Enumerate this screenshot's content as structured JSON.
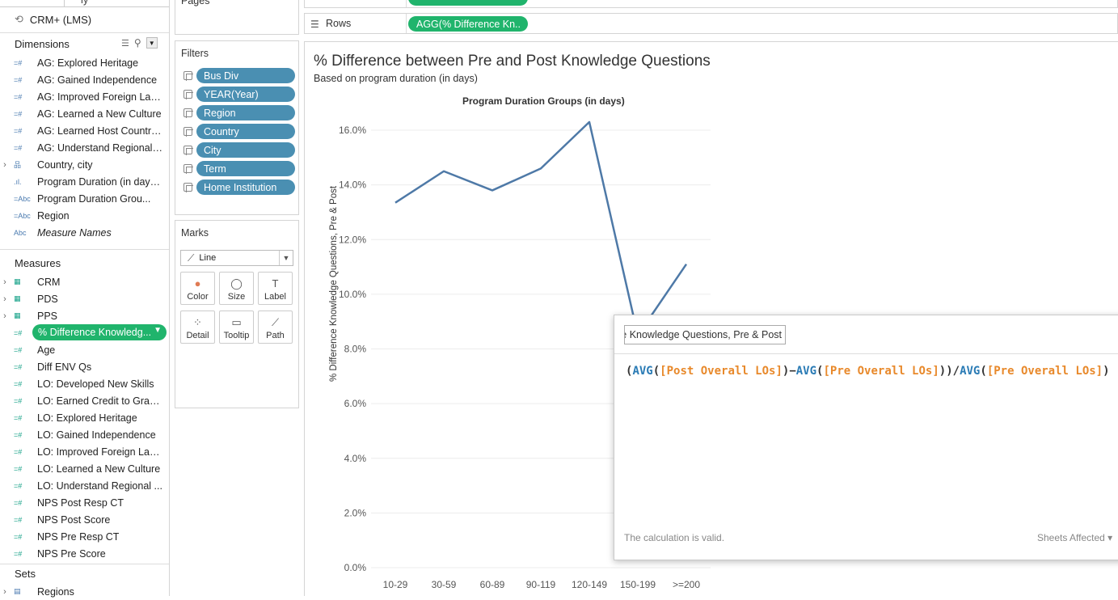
{
  "datasource": {
    "name": "CRM+ (LMS)",
    "tab_partial": "ly"
  },
  "dimensions": {
    "header": "Dimensions",
    "items": [
      {
        "icon": "=#",
        "label": "AG: Explored Heritage"
      },
      {
        "icon": "=#",
        "label": "AG: Gained Independence"
      },
      {
        "icon": "=#",
        "label": "AG: Improved Foreign Lan..."
      },
      {
        "icon": "=#",
        "label": "AG: Learned a New Culture"
      },
      {
        "icon": "=#",
        "label": "AG: Learned Host Country..."
      },
      {
        "icon": "=#",
        "label": "AG: Understand Regional ..."
      },
      {
        "icon": "品",
        "label": "Country, city"
      },
      {
        "icon": ".ıl.",
        "label": "Program Duration (in days..."
      },
      {
        "icon": "=Abc",
        "label": "Program Duration Grou..."
      },
      {
        "icon": "=Abc",
        "label": "Region"
      },
      {
        "icon": "Abc",
        "label": "Measure Names"
      }
    ]
  },
  "measures": {
    "header": "Measures",
    "items": [
      {
        "icon": "▦",
        "label": "CRM"
      },
      {
        "icon": "▦",
        "label": "PDS"
      },
      {
        "icon": "▦",
        "label": "PPS"
      },
      {
        "icon": "=#",
        "label": "% Difference Knowledg..."
      },
      {
        "icon": "=#",
        "label": "Age"
      },
      {
        "icon": "=#",
        "label": "Diff ENV Qs"
      },
      {
        "icon": "=#",
        "label": "LO: Developed New Skills"
      },
      {
        "icon": "=#",
        "label": "LO: Earned Credit to Grad..."
      },
      {
        "icon": "=#",
        "label": "LO: Explored Heritage"
      },
      {
        "icon": "=#",
        "label": "LO: Gained Independence"
      },
      {
        "icon": "=#",
        "label": "LO: Improved Foreign Lan..."
      },
      {
        "icon": "=#",
        "label": "LO: Learned a New Culture"
      },
      {
        "icon": "=#",
        "label": "LO: Understand Regional ..."
      },
      {
        "icon": "=#",
        "label": "NPS Post Resp CT"
      },
      {
        "icon": "=#",
        "label": "NPS Post Score"
      },
      {
        "icon": "=#",
        "label": "NPS Pre Resp CT"
      },
      {
        "icon": "=#",
        "label": "NPS Pre Score"
      }
    ]
  },
  "sets": {
    "header": "Sets",
    "items": [
      {
        "icon": "▤",
        "label": "Regions"
      }
    ]
  },
  "pages_card": {
    "title": "Pages"
  },
  "filters_card": {
    "title": "Filters",
    "items": [
      "Bus Div",
      "YEAR(Year)",
      "Region",
      "Country",
      "City",
      "Term",
      "Home Institution"
    ]
  },
  "marks_card": {
    "title": "Marks",
    "mark_type": "Line",
    "buttons": [
      {
        "label": "Color",
        "icon": "color-icon"
      },
      {
        "label": "Size",
        "icon": "size-icon"
      },
      {
        "label": "Label",
        "icon": "label-icon"
      },
      {
        "label": "Detail",
        "icon": "detail-icon"
      },
      {
        "label": "Tooltip",
        "icon": "tooltip-icon"
      },
      {
        "label": "Path",
        "icon": "path-icon"
      }
    ]
  },
  "shelves": {
    "rows_label": "Rows",
    "rows_pill": "AGG(% Difference Kn.."
  },
  "view": {
    "title": "% Difference between Pre and Post Knowledge Questions",
    "subtitle": "Based on program duration (in days)"
  },
  "chart_data": {
    "type": "line",
    "title": "Program Duration Groups (in days)",
    "xlabel": "",
    "ylabel": "% Difference Knowledge Questions, Pre & Post",
    "categories": [
      "10-29",
      "30-59",
      "60-89",
      "90-119",
      "120-149",
      "150-199",
      ">=200"
    ],
    "series": [
      {
        "values": [
          13.35,
          14.5,
          13.8,
          14.6,
          16.3,
          8.5,
          11.1
        ],
        "color": "#4e79a7"
      }
    ],
    "yticks": [
      "0.0%",
      "2.0%",
      "4.0%",
      "6.0%",
      "8.0%",
      "10.0%",
      "12.0%",
      "14.0%",
      "16.0%"
    ],
    "ylim": [
      0,
      16.8
    ],
    "grid": true
  },
  "calc_editor": {
    "name_value": "% Difference Knowledge Questions, Pre & Post",
    "formula": {
      "p1": "(",
      "f1": "AVG",
      "p2": "(",
      "a1": "[Post Overall LOs]",
      "p3": ")−",
      "f2": "AVG",
      "p4": "(",
      "a2": "[Pre Overall LOs]",
      "p5": "))/",
      "f3": "AVG",
      "p6": "(",
      "a3": "[Pre Overall LOs]",
      "p7": ")"
    },
    "status": "The calculation is valid.",
    "sheets_affected": "Sheets Affected ▾"
  },
  "colors": {
    "measure_pill": "#20b46c",
    "filter_pill": "#4a8fb2",
    "line": "#4e79a7"
  }
}
